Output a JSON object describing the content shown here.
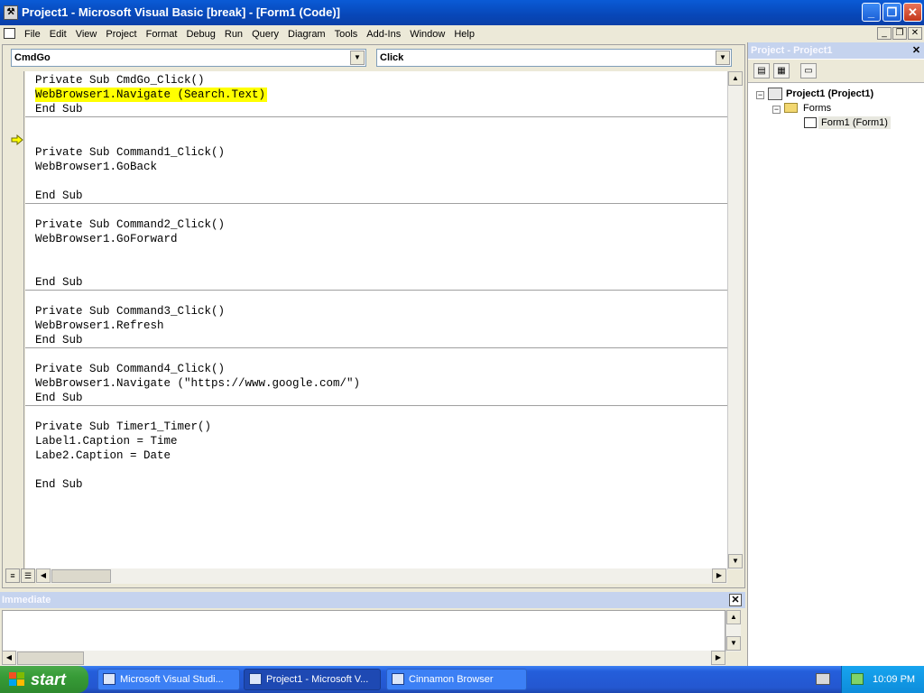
{
  "window": {
    "title": "Project1 - Microsoft Visual Basic [break] - [Form1 (Code)]",
    "min_glyph": "_",
    "restore_glyph": "❐",
    "close_glyph": "✕"
  },
  "menu": {
    "items": [
      "File",
      "Edit",
      "View",
      "Project",
      "Format",
      "Debug",
      "Run",
      "Query",
      "Diagram",
      "Tools",
      "Add-Ins",
      "Window",
      "Help"
    ]
  },
  "code_window": {
    "object_combo": "CmdGo",
    "procedure_combo": "Click",
    "current_line_index": 1,
    "lines": [
      "Private Sub CmdGo_Click()",
      "WebBrowser1.Navigate (Search.Text)",
      "End Sub",
      "Private Sub Command1_Click()",
      "WebBrowser1.GoBack",
      "End Sub",
      "Private Sub Command2_Click()",
      "WebBrowser1.GoForward",
      "End Sub",
      "Private Sub Command3_Click()",
      "WebBrowser1.Refresh",
      "End Sub",
      "Private Sub Command4_Click()",
      "WebBrowser1.Navigate (\"https://www.google.com/\")",
      "End Sub",
      "Private Sub Timer1_Timer()",
      "Label1.Caption = Time",
      "Labe2.Caption = Date",
      "End Sub"
    ]
  },
  "project_explorer": {
    "title": "Project - Project1",
    "root": "Project1 (Project1)",
    "folder": "Forms",
    "form": "Form1 (Form1)"
  },
  "immediate": {
    "title": "Immediate",
    "content": ""
  },
  "taskbar": {
    "start": "start",
    "tasks": [
      "Microsoft Visual Studi...",
      "Project1 - Microsoft V...",
      "Cinnamon Browser"
    ],
    "active_task_index": 1,
    "clock": "10:09 PM"
  },
  "colors": {
    "titlebar": "#0a5bd6",
    "current_line_highlight": "#ffff00",
    "exec_arrow": "#ffff00",
    "taskbar": "#245edb",
    "start_button": "#379b37"
  }
}
